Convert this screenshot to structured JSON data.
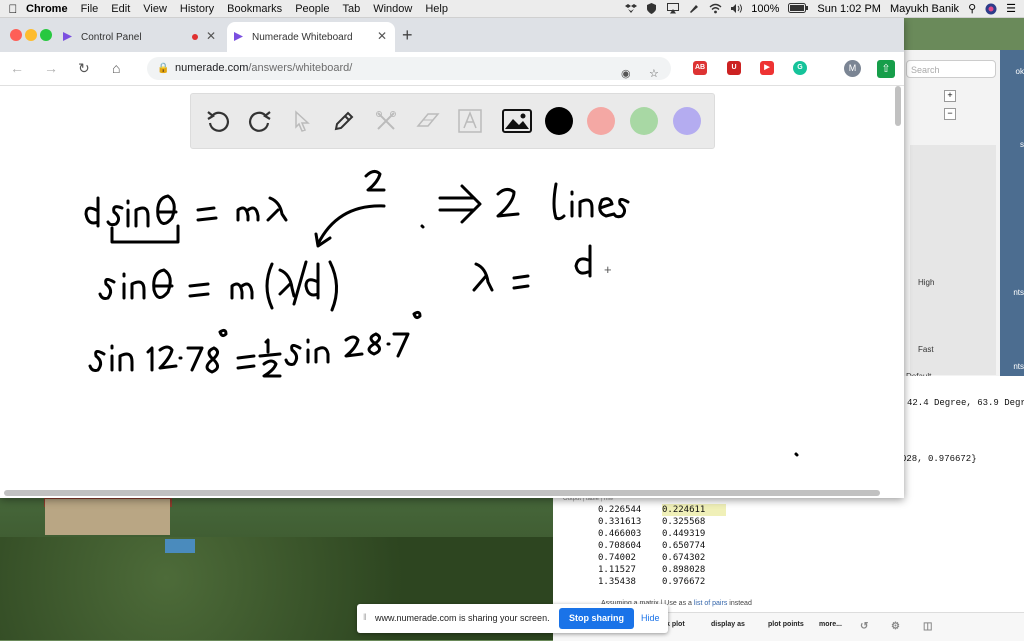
{
  "menubar": {
    "app": "Chrome",
    "items": [
      "File",
      "Edit",
      "View",
      "History",
      "Bookmarks",
      "People",
      "Tab",
      "Window",
      "Help"
    ],
    "battery": "100%",
    "clock": "Sun 1:02 PM",
    "user": "Mayukh Banik"
  },
  "tabs": [
    {
      "title": "Control Panel",
      "active": false
    },
    {
      "title": "Numerade Whiteboard",
      "active": true
    }
  ],
  "omnibox": {
    "host": "numerade.com",
    "path": "/answers/whiteboard/"
  },
  "profile_initial": "M",
  "whiteboard": {
    "tools": [
      "undo-icon",
      "redo-icon",
      "pointer-icon",
      "pen-icon",
      "tools-icon",
      "eraser-icon",
      "text-icon",
      "image-icon"
    ],
    "colors": [
      "#000000",
      "#f4a8a4",
      "#a8d8a4",
      "#b4acf0"
    ]
  },
  "bgapp": {
    "search_placeholder": "Search",
    "high": "High",
    "fast": "Fast",
    "default": "Default",
    "sidebar_text": [
      "ok",
      "s",
      "nts",
      "nts"
    ]
  },
  "bgdata": {
    "result_line": "42.4 Degree, 63.9 Degr",
    "result_line2": "028, 0.976672}",
    "small_label": "Output | table | mw",
    "rows": [
      [
        "0.226544",
        "0.224611"
      ],
      [
        "0.331613",
        "0.325568"
      ],
      [
        "0.466003",
        "0.449319"
      ],
      [
        "0.708604",
        "0.650774"
      ],
      [
        "0.74002",
        "0.674302"
      ],
      [
        "1.11527",
        "0.898028"
      ],
      [
        "1.35438",
        "0.976672"
      ]
    ],
    "assume_prefix": "Assuming a matrix | Use as a ",
    "assume_link": "list of pairs",
    "assume_suffix": " instead",
    "bar_buttons": [
      "k plot",
      "display as",
      "plot points",
      "more..."
    ]
  },
  "share": {
    "message": "www.numerade.com is sharing your screen.",
    "stop": "Stop sharing",
    "hide": "Hide"
  }
}
